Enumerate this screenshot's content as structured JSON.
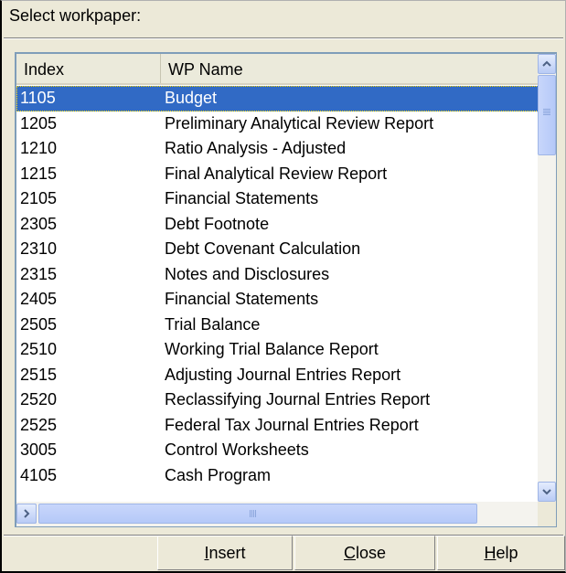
{
  "dialog": {
    "prompt": "Select workpaper:"
  },
  "list": {
    "columns": {
      "index": "Index",
      "wp_name": "WP Name"
    },
    "selected_row": 0,
    "rows": [
      {
        "index": "1105",
        "name": "Budget"
      },
      {
        "index": "1205",
        "name": "Preliminary Analytical Review Report"
      },
      {
        "index": "1210",
        "name": "Ratio Analysis - Adjusted"
      },
      {
        "index": "1215",
        "name": "Final Analytical Review Report"
      },
      {
        "index": "2105",
        "name": "Financial Statements"
      },
      {
        "index": "2305",
        "name": "Debt Footnote"
      },
      {
        "index": "2310",
        "name": "Debt Covenant Calculation"
      },
      {
        "index": "2315",
        "name": "Notes and Disclosures"
      },
      {
        "index": "2405",
        "name": "Financial Statements"
      },
      {
        "index": "2505",
        "name": "Trial Balance"
      },
      {
        "index": "2510",
        "name": "Working Trial Balance Report"
      },
      {
        "index": "2515",
        "name": "Adjusting Journal Entries Report"
      },
      {
        "index": "2520",
        "name": "Reclassifying Journal Entries Report"
      },
      {
        "index": "2525",
        "name": "Federal Tax Journal Entries Report"
      },
      {
        "index": "3005",
        "name": "Control Worksheets"
      },
      {
        "index": "4105",
        "name": "Cash Program"
      }
    ]
  },
  "buttons": {
    "insert": {
      "mnemonic": "I",
      "rest": "nsert"
    },
    "close": {
      "mnemonic": "C",
      "rest": "lose"
    },
    "help": {
      "mnemonic": "H",
      "rest": "elp"
    }
  },
  "colors": {
    "selection": "#316ac5",
    "dialog_bg": "#ece9d8",
    "list_border": "#7f9db9"
  },
  "icons": [
    "scroll-up-arrow-icon",
    "scroll-down-arrow-icon",
    "scroll-left-arrow-icon",
    "scroll-right-arrow-icon"
  ]
}
